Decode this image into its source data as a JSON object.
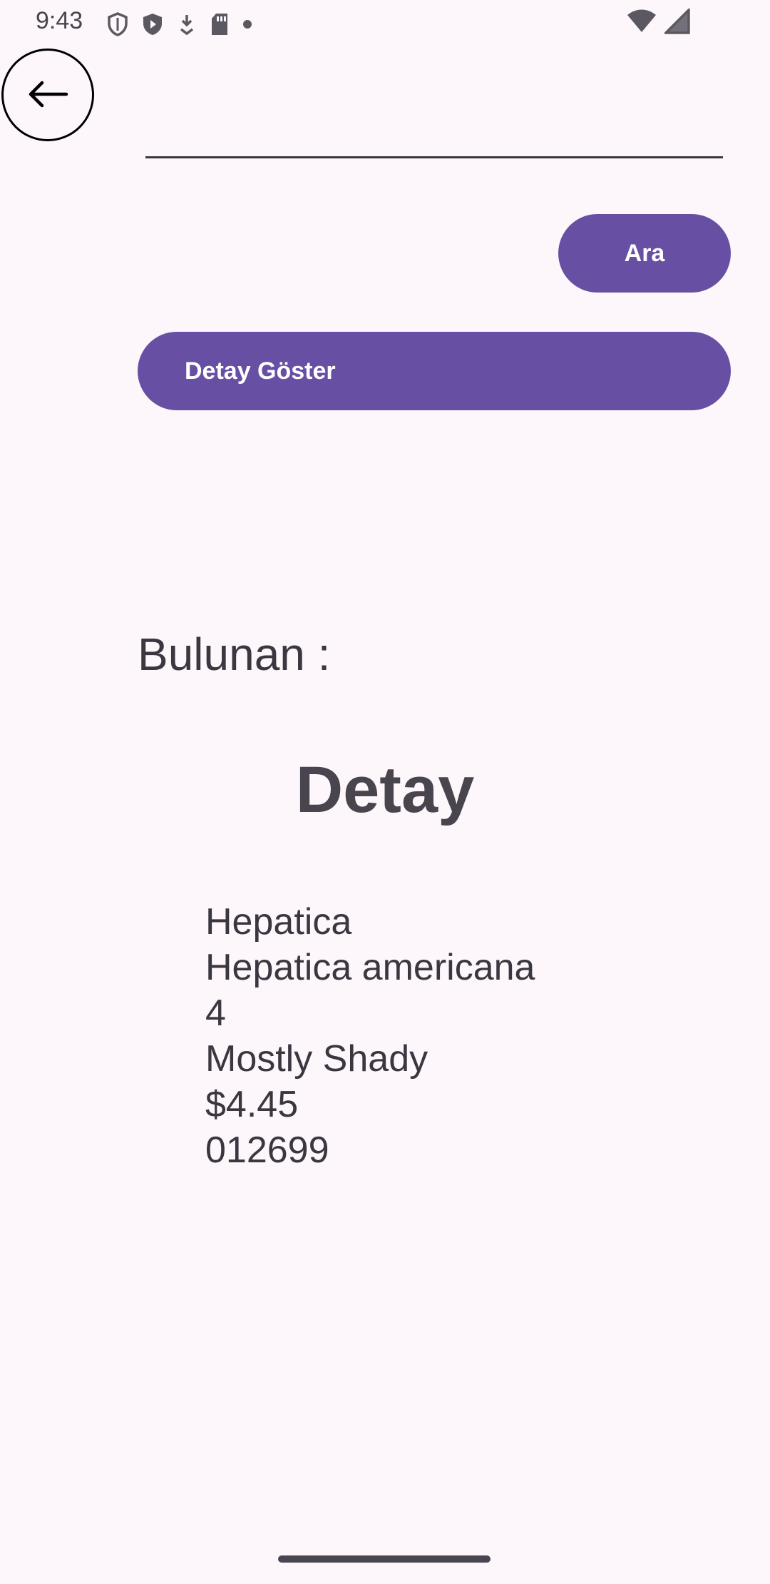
{
  "status_bar": {
    "time": "9:43",
    "icons": [
      "shield-outline-icon",
      "shield-play-icon",
      "download-icon",
      "sd-card-icon",
      "dot-icon",
      "wifi-icon",
      "signal-icon"
    ]
  },
  "header": {
    "back_icon": "arrow-left-icon"
  },
  "search": {
    "value": "",
    "placeholder": "",
    "button_label": "Ara"
  },
  "detail_button_label": "Detay Göster",
  "found_label": "Bulunan :",
  "detail": {
    "title": "Detay",
    "lines": [
      "Hepatica",
      "Hepatica americana",
      "4",
      "Mostly Shady",
      "$4.45",
      "012699"
    ]
  },
  "colors": {
    "background": "#fdf7fb",
    "accent": "#6750a4",
    "text": "#3a3740"
  }
}
